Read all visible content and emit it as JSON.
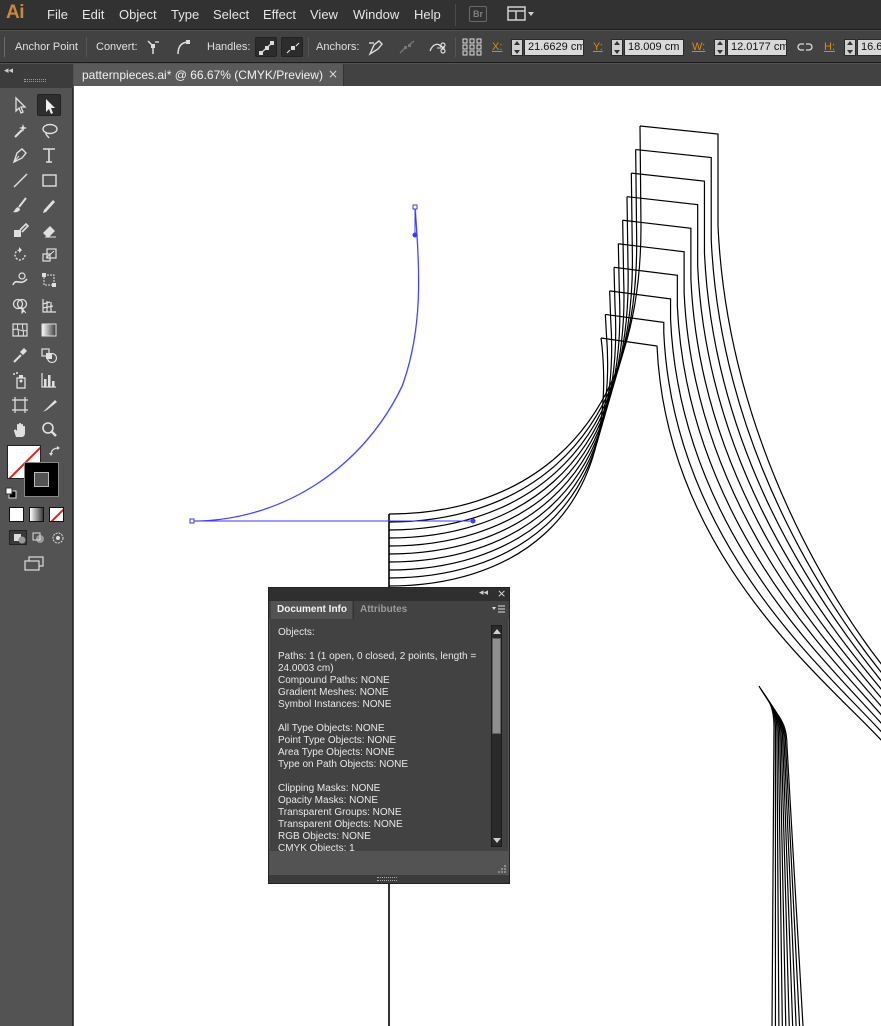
{
  "app": {
    "logo_text": "Ai",
    "brand_color": "#c58a3c",
    "bridge_label": "Br"
  },
  "menu": {
    "items": [
      "File",
      "Edit",
      "Object",
      "Type",
      "Select",
      "Effect",
      "View",
      "Window",
      "Help"
    ]
  },
  "control_bar": {
    "tool_label": "Anchor Point",
    "convert_label": "Convert:",
    "handles_label": "Handles:",
    "anchors_label": "Anchors:",
    "x_label": "X:",
    "x_value": "21.6629 cm",
    "y_label": "Y:",
    "y_value": "18.009 cm",
    "w_label": "W:",
    "w_value": "12.0177 cm",
    "h_label": "H:",
    "h_value": "16.6",
    "accent_color": "#e08a00"
  },
  "document": {
    "tab_title": "patternpieces.ai* @ 66.67% (CMYK/Preview)",
    "close_glyph": "×"
  },
  "tools": {
    "collapse_glyph": "◂◂",
    "icons": [
      "selection-tool-icon",
      "direct-selection-tool-icon",
      "magic-wand-tool-icon",
      "lasso-tool-icon",
      "pen-tool-icon",
      "type-tool-icon",
      "line-segment-tool-icon",
      "rectangle-tool-icon",
      "paintbrush-tool-icon",
      "pencil-tool-icon",
      "blob-brush-tool-icon",
      "eraser-tool-icon",
      "rotate-tool-icon",
      "scale-tool-icon",
      "warp-tool-icon",
      "free-transform-tool-icon",
      "shape-builder-tool-icon",
      "perspective-grid-tool-icon",
      "mesh-tool-icon",
      "gradient-tool-icon",
      "eyedropper-tool-icon",
      "blend-tool-icon",
      "symbol-sprayer-tool-icon",
      "column-graph-tool-icon",
      "artboard-tool-icon",
      "slice-tool-icon",
      "hand-tool-icon",
      "zoom-tool-icon"
    ]
  },
  "doc_info_panel": {
    "collapse_glyph": "◂◂",
    "close_glyph": "×",
    "tab_active": "Document Info",
    "tab_inactive": "Attributes",
    "content": "Objects:\n\nPaths: 1 (1 open, 0 closed, 2 points, length = 24.0003 cm)\nCompound Paths: NONE\nGradient Meshes: NONE\nSymbol Instances: NONE\n\nAll Type Objects: NONE\nPoint Type Objects: NONE\nArea Type Objects: NONE\nType on Path Objects: NONE\n\nClipping Masks: NONE\nOpacity Masks: NONE\nTransparent Groups: NONE\nTransparent Objects: NONE\nRGB Objects: NONE\nCMYK Objects: 1"
  },
  "colors": {
    "selection_path": "#3a3aff",
    "fill_swatch": "#ffffff",
    "stroke_swatch": "#000000",
    "none_slash": "#e0201e"
  }
}
